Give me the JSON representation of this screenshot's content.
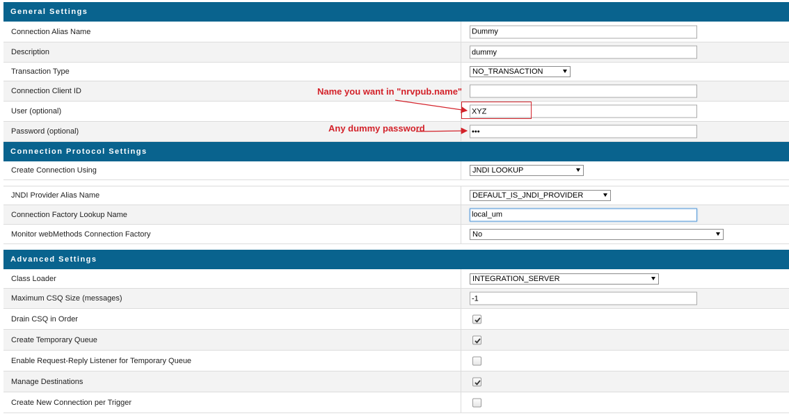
{
  "sections": {
    "general": "General Settings",
    "protocol": "Connection Protocol Settings",
    "advanced": "Advanced Settings"
  },
  "general": {
    "alias": {
      "label": "Connection Alias Name",
      "value": "Dummy"
    },
    "description": {
      "label": "Description",
      "value": "dummy"
    },
    "transaction": {
      "label": "Transaction Type",
      "value": "NO_TRANSACTION"
    },
    "client_id": {
      "label": "Connection Client ID",
      "value": ""
    },
    "user": {
      "label": "User (optional)",
      "value": "XYZ"
    },
    "password": {
      "label": "Password (optional)",
      "value": "•••"
    }
  },
  "protocol": {
    "create_using": {
      "label": "Create Connection Using",
      "value": "JNDI LOOKUP"
    },
    "jndi_alias": {
      "label": "JNDI Provider Alias Name",
      "value": "DEFAULT_IS_JNDI_PROVIDER"
    },
    "factory_lookup": {
      "label": "Connection Factory Lookup Name",
      "value": "local_um"
    },
    "monitor": {
      "label": "Monitor webMethods Connection Factory",
      "value": "No"
    }
  },
  "advanced": {
    "class_loader": {
      "label": "Class Loader",
      "value": "INTEGRATION_SERVER"
    },
    "csq_size": {
      "label": "Maximum CSQ Size (messages)",
      "value": "-1"
    },
    "drain_csq": {
      "label": "Drain CSQ in Order",
      "checked": true
    },
    "temp_queue": {
      "label": "Create Temporary Queue",
      "checked": true
    },
    "req_reply": {
      "label": "Enable Request-Reply Listener for Temporary Queue",
      "checked": false
    },
    "manage_dest": {
      "label": "Manage Destinations",
      "checked": true
    },
    "new_conn": {
      "label": "Create New Connection per Trigger",
      "checked": false
    }
  },
  "annotations": {
    "user_note": "Name you want in \"nrvpub.name\"",
    "password_note": "Any dummy password"
  },
  "colors": {
    "header": "#09638e",
    "annotation": "#d3222a"
  }
}
